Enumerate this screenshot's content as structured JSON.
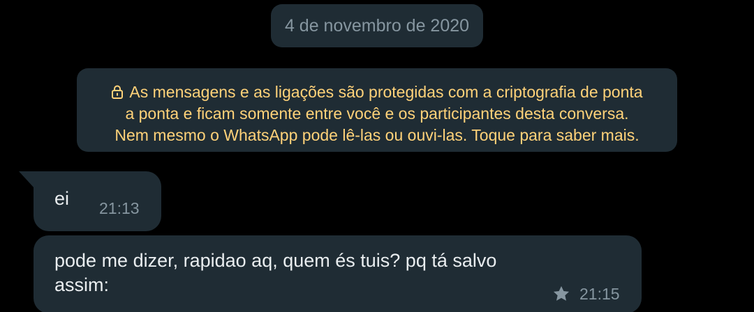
{
  "date_chip": "4 de novembro de 2020",
  "encryption_notice": {
    "icon": "lock-icon",
    "lines": [
      "As mensagens e as ligações são protegidas com a criptografia de ponta",
      "a ponta e ficam somente entre você e os participantes desta conversa.",
      "Nem mesmo o WhatsApp pode lê-las ou ouvi-las. Toque para saber mais."
    ],
    "color": "#ffd279"
  },
  "messages": [
    {
      "direction": "incoming",
      "lines": [
        "ei"
      ],
      "time": "21:13",
      "starred": false
    },
    {
      "direction": "incoming",
      "lines": [
        "pode me dizer, rapidao aq, quem és tuis? pq tá salvo",
        "assim:"
      ],
      "time": "21:15",
      "starred": true,
      "star_icon": "star-icon"
    }
  ],
  "colors": {
    "background": "#000000",
    "bubble": "#1f2c34",
    "text": "#e9edef",
    "meta": "#8696a0"
  }
}
